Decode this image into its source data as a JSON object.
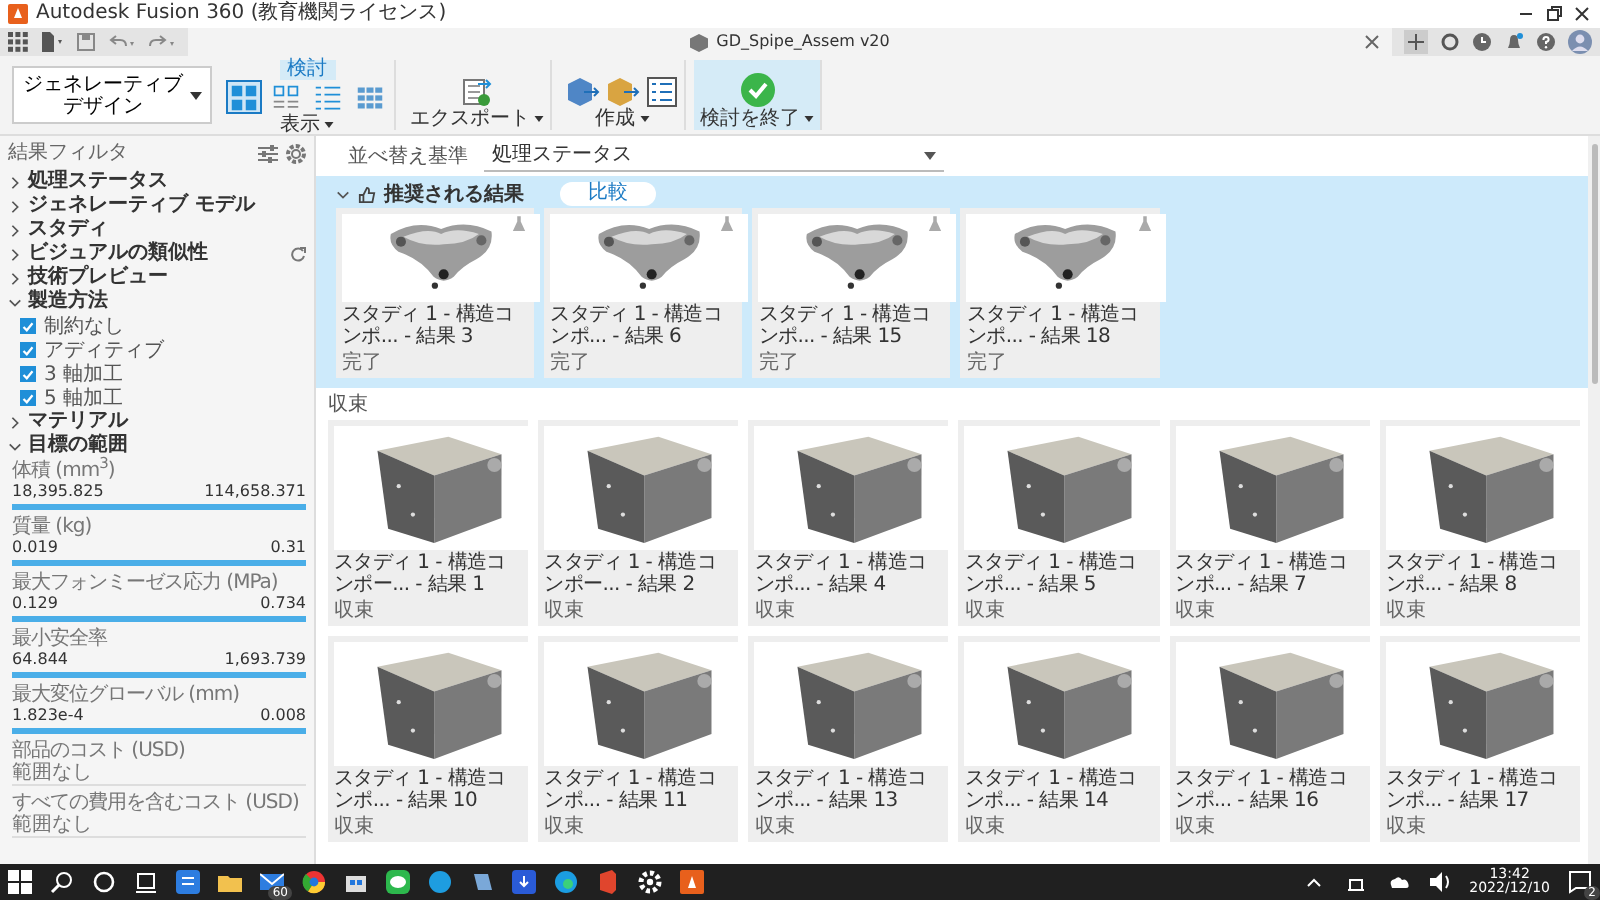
{
  "window": {
    "title": "Autodesk Fusion 360 (教育機関ライセンス)"
  },
  "document_tab": {
    "title": "GD_Spipe_Assem v20"
  },
  "workspace_button": {
    "label": "ジェネレーティブデザイン"
  },
  "ribbon": {
    "tab": {
      "label": "検討",
      "selected": true
    },
    "groups": [
      {
        "kind": "view",
        "label": "表示",
        "tools": [
          {
            "kind": "grid",
            "selected": true
          },
          {
            "kind": "cards",
            "selected": false
          },
          {
            "kind": "list",
            "selected": false
          },
          {
            "kind": "table",
            "selected": false
          }
        ]
      },
      {
        "kind": "export",
        "label": "エクスポート"
      },
      {
        "kind": "create",
        "label": "作成"
      },
      {
        "kind": "finish",
        "label": "検討を終了"
      }
    ]
  },
  "sidebar": {
    "title": "結果フィルタ",
    "sections": [
      {
        "label": "処理ステータス",
        "expanded": false,
        "reset": false
      },
      {
        "label": "ジェネレーティブ モデル",
        "expanded": false,
        "reset": false
      },
      {
        "label": "スタディ",
        "expanded": false,
        "reset": false
      },
      {
        "label": "ビジュアルの類似性",
        "expanded": false,
        "reset": true
      },
      {
        "label": "技術プレビュー",
        "expanded": false,
        "reset": false
      },
      {
        "label": "製造方法",
        "expanded": true,
        "reset": false,
        "options": [
          {
            "label": "制約なし",
            "checked": true
          },
          {
            "label": "アディティブ",
            "checked": true
          },
          {
            "label": "3 軸加工",
            "checked": true
          },
          {
            "label": "5 軸加工",
            "checked": true
          }
        ]
      },
      {
        "label": "マテリアル",
        "expanded": false,
        "reset": false
      },
      {
        "label": "目標の範囲",
        "expanded": true,
        "reset": false,
        "ranges": [
          {
            "kind": "slider",
            "label": "体積 (mm$^{3}$)",
            "min": "18,395.825",
            "max": "114,658.371",
            "level": 1
          },
          {
            "kind": "slider",
            "label": "質量 (kg)",
            "min": "0.019",
            "max": "0.31",
            "level": 1
          },
          {
            "kind": "slider",
            "label": "最大フォンミーゼス応力 (MPa)",
            "min": "0.129",
            "max": "0.734",
            "level": 1
          },
          {
            "kind": "slider",
            "label": "最小安全率",
            "min": "64.844",
            "max": "1,693.739",
            "level": 1
          },
          {
            "kind": "slider",
            "label": "最大変位グローバル (mm)",
            "min": "1.823e-4",
            "max": "0.008",
            "level": 1
          },
          {
            "kind": "empty",
            "label": "部品のコスト (USD)",
            "note": "範囲なし"
          },
          {
            "kind": "empty",
            "label": "すべての費用を含むコスト (USD)",
            "note": "範囲なし"
          }
        ]
      }
    ]
  },
  "sort": {
    "label": "並べ替え基準",
    "value": "処理ステータス"
  },
  "recommended": {
    "title": "推奨される結果",
    "compare_button": "比較",
    "expanded": true,
    "results": [
      {
        "title": "スタディ 1 - 構造コンポ...",
        "result": "- 結果 3",
        "status": "完了"
      },
      {
        "title": "スタディ 1 - 構造コンポ...",
        "result": "- 結果 6",
        "status": "完了"
      },
      {
        "title": "スタディ 1 - 構造コンポ...",
        "result": "- 結果 15",
        "status": "完了"
      },
      {
        "title": "スタディ 1 - 構造コンポ...",
        "result": "- 結果 18",
        "status": "完了"
      }
    ]
  },
  "converged": {
    "title": "収束",
    "results": [
      {
        "title": "スタディ 1 - 構造コンポー...",
        "result": "- 結果 1",
        "status": "収束"
      },
      {
        "title": "スタディ 1 - 構造コンポー...",
        "result": "- 結果 2",
        "status": "収束"
      },
      {
        "title": "スタディ 1 - 構造コンポ...",
        "result": "- 結果 4",
        "status": "収束"
      },
      {
        "title": "スタディ 1 - 構造コンポ...",
        "result": "- 結果 5",
        "status": "収束"
      },
      {
        "title": "スタディ 1 - 構造コンポ...",
        "result": "- 結果 7",
        "status": "収束"
      },
      {
        "title": "スタディ 1 - 構造コンポ...",
        "result": "- 結果 8",
        "status": "収束"
      },
      {
        "title": "スタディ 1 - 構造コンポ...",
        "result": "- 結果 10",
        "status": "収束"
      },
      {
        "title": "スタディ 1 - 構造コンポ...",
        "result": "- 結果 11",
        "status": "収束"
      },
      {
        "title": "スタディ 1 - 構造コンポ...",
        "result": "- 結果 13",
        "status": "収束"
      },
      {
        "title": "スタディ 1 - 構造コンポ...",
        "result": "- 結果 14",
        "status": "収束"
      },
      {
        "title": "スタディ 1 - 構造コンポ...",
        "result": "- 結果 16",
        "status": "収束"
      },
      {
        "title": "スタディ 1 - 構造コンポ...",
        "result": "- 結果 17",
        "status": "収束"
      }
    ]
  },
  "taskbar": {
    "mail_badge": "60",
    "time": "13:42",
    "date": "2022/12/10",
    "notification_count": "2"
  }
}
